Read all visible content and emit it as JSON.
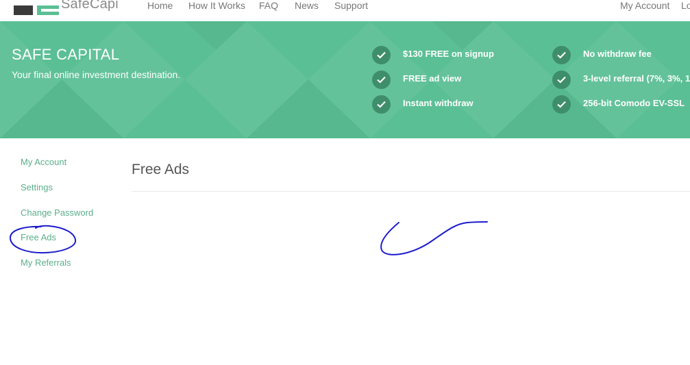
{
  "nav": {
    "brand": "SafeCapi",
    "links": [
      "Home",
      "How It Works",
      "FAQ",
      "News",
      "Support"
    ],
    "account": "My Account",
    "login_partial": "Lo"
  },
  "hero": {
    "title": "SAFE CAPITAL",
    "subtitle": "Your final online investment destination.",
    "features": [
      "$130 FREE on signup",
      "FREE ad view",
      "Instant withdraw",
      "No withdraw fee",
      "3-level referral (7%, 3%, 1",
      "256-bit Comodo EV-SSL"
    ],
    "feature_icon": "check-circle-icon"
  },
  "sidebar": {
    "items": [
      "My Account",
      "Settings",
      "Change Password",
      "Free Ads",
      "My Referrals"
    ],
    "active": "Free Ads"
  },
  "main": {
    "title": "Free Ads"
  },
  "colors": {
    "brand_green": "#5bbf95",
    "link_green": "#5bae8c",
    "check_bg": "#3e8e6b",
    "annotation": "#1a1acc"
  }
}
